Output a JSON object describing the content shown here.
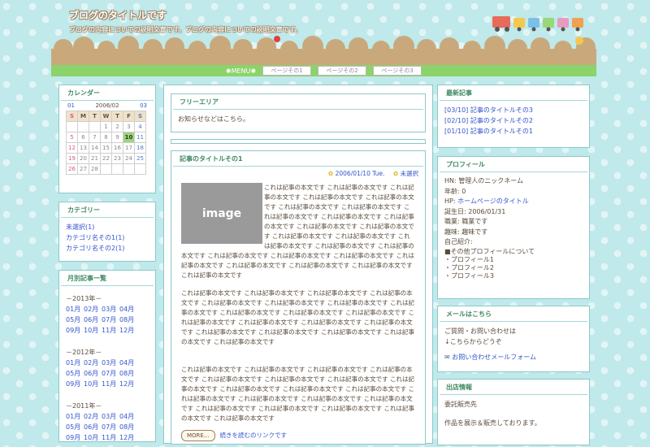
{
  "header": {
    "title": "ブログのタイトルです",
    "description": "ブログの内容についての説明文章です。ブログの内容についての説明文章です。"
  },
  "menu": {
    "label": "✱MENU✱",
    "items": [
      "ページその1",
      "ページその2",
      "ページその3"
    ]
  },
  "calendar": {
    "title": "カレンダー",
    "prev": "01",
    "current": "2006/02",
    "next": "03",
    "weekdays": [
      "S",
      "M",
      "T",
      "W",
      "T",
      "F",
      "S"
    ],
    "weeks": [
      [
        "",
        "",
        "",
        "1",
        "2",
        "3",
        "4"
      ],
      [
        "5",
        "6",
        "7",
        "8",
        "9",
        "10",
        "11"
      ],
      [
        "12",
        "13",
        "14",
        "15",
        "16",
        "17",
        "18"
      ],
      [
        "19",
        "20",
        "21",
        "22",
        "23",
        "24",
        "25"
      ],
      [
        "26",
        "27",
        "28",
        "",
        "",
        "",
        ""
      ]
    ],
    "today": "10"
  },
  "categories": {
    "title": "カテゴリー",
    "items": [
      "未選択(1)",
      "カテゴリ名その1(1)",
      "カテゴリ名その2(1)"
    ]
  },
  "archive": {
    "title": "月別記事一覧",
    "years": [
      {
        "label": "－2013年－",
        "months": [
          "01月",
          "02月",
          "03月",
          "04月",
          "05月",
          "06月",
          "07月",
          "08月",
          "09月",
          "10月",
          "11月",
          "12月"
        ]
      },
      {
        "label": "－2012年－",
        "months": [
          "01月",
          "02月",
          "03月",
          "04月",
          "05月",
          "06月",
          "07月",
          "08月",
          "09月",
          "10月",
          "11月",
          "12月"
        ]
      },
      {
        "label": "－2011年－",
        "months": [
          "01月",
          "02月",
          "03月",
          "04月",
          "05月",
          "06月",
          "07月",
          "08月",
          "09月",
          "10月",
          "11月",
          "12月"
        ]
      }
    ]
  },
  "free_area": {
    "title": "フリーエリア",
    "text": "お知らせなどはこちら。"
  },
  "article": {
    "title": "記事のタイトルその1",
    "date": "2006/01/10 Tue.",
    "category": "未選択",
    "image_label": "image",
    "para1": "これは記事の本文です これは記事の本文です これは記事の本文です これは記事の本文です これは記事の本文です これは記事の本文です これは記事の本文です これは記事の本文です これは記事の本文です これは記事の本文です これは記事の本文です これは記事の本文です これは記事の本文です これは記事の本文です これは記事の本文です これは記事の本文です これは記事の本文です これは記事の本文です これは記事の本文です これは記事の本文です これは記事の本文です これは記事の本文です これは記事の本文です これは記事の本文です これは記事の本文です",
    "para2": "これは記事の本文です これは記事の本文です これは記事の本文です これは記事の本文です これは記事の本文です これは記事の本文です これは記事の本文です これは記事の本文です これは記事の本文です これは記事の本文です これは記事の本文です これは記事の本文です これは記事の本文です これは記事の本文です これは記事の本文です これは記事の本文です これは記事の本文です これは記事の本文です これは記事の本文です これは記事の本文です",
    "para3": "これは記事の本文です これは記事の本文です これは記事の本文です これは記事の本文です これは記事の本文です これは記事の本文です これは記事の本文です これは記事の本文です これは記事の本文です これは記事の本文です これは記事の本文です これは記事の本文です これは記事の本文です これは記事の本文です これは記事の本文です これは記事の本文です これは記事の本文です これは記事の本文です これは記事の本文です これは記事の本文です",
    "more_label": "MORE...",
    "more_link": "続きを読むのリンクです"
  },
  "recent": {
    "title": "最新記事",
    "items": [
      "[03/10] 記事のタイトルその3",
      "[02/10] 記事のタイトルその2",
      "[01/10] 記事のタイトルその1"
    ]
  },
  "profile": {
    "title": "プロフィール",
    "hn": "HN: 管理人のニックネーム",
    "age": "年齢: 0",
    "hp_label": "HP:",
    "hp_link": "ホームページのタイトル",
    "birthday": "誕生日: 2006/01/31",
    "job": "職業: 職業です",
    "hobby": "趣味: 趣味です",
    "intro_label": "自己紹介:",
    "intro_lines": [
      "■その他プロフィールについて",
      "・プロフィール1",
      "・プロフィール2",
      "・プロフィール3"
    ]
  },
  "mail": {
    "title": "メールはこちら",
    "line1": "ご質問・お問い合わせは",
    "line2": "↓こちらからどうぞ",
    "link": "お問い合わせメールフォーム"
  },
  "shop": {
    "title": "出店情報",
    "line1": "委託販売先",
    "line2": "作品を展示＆販売しております。"
  },
  "colors": {
    "accent_green": "#8bd36a",
    "heading_green": "#3d8a62",
    "link_blue": "#3355cc",
    "bg_aqua": "#bfe9ea"
  }
}
